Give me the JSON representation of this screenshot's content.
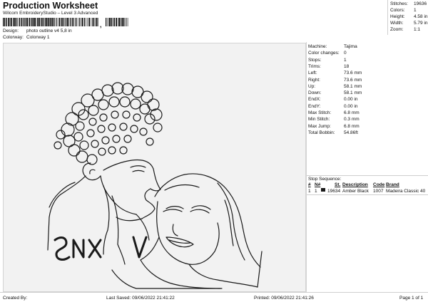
{
  "header": {
    "title": "Production Worksheet",
    "subtitle": "Wilcom EmbroideryStudio – Level 3 Advanced",
    "barcode_suffix": ","
  },
  "info": {
    "design_label": "Design:",
    "design_value": "photo outline v4 5,8 in",
    "colorway_label": "Colorway:",
    "colorway_value": "Colorway 1"
  },
  "summary": {
    "stitches_label": "Stitches:",
    "stitches_value": "19636",
    "colors_label": "Colors:",
    "colors_value": "1",
    "height_label": "Height:",
    "height_value": "4.58 in",
    "width_label": "Width:",
    "width_value": "5.79 in",
    "zoom_label": "Zoom:",
    "zoom_value": "1:1"
  },
  "stats": [
    {
      "label": "Machine:",
      "value": "Tajima"
    },
    {
      "label": "Color changes:",
      "value": "0"
    },
    {
      "label": "Stops:",
      "value": "1"
    },
    {
      "label": "Trims:",
      "value": "18"
    },
    {
      "label": "Left:",
      "value": "73.6 mm"
    },
    {
      "label": "Right:",
      "value": "73.6 mm"
    },
    {
      "label": "Up:",
      "value": "58.1 mm"
    },
    {
      "label": "Down:",
      "value": "58.1 mm"
    },
    {
      "label": "EndX:",
      "value": "0.00 in"
    },
    {
      "label": "EndY:",
      "value": "0.00 in"
    },
    {
      "label": "Max Stitch:",
      "value": "6.8 mm"
    },
    {
      "label": "Min Stitch:",
      "value": "0.3 mm"
    },
    {
      "label": "Max Jump:",
      "value": "6.8 mm"
    },
    {
      "label": "Total Bobbin:",
      "value": "54.86ft"
    }
  ],
  "stop_sequence": {
    "label": "Stop Sequence:",
    "columns": {
      "num": "#",
      "n": "N#",
      "st": "St.",
      "description": "Description",
      "code": "Code",
      "brand": "Brand"
    },
    "rows": [
      {
        "num": "1",
        "n": "1",
        "st": "19634",
        "description": "Amber Black",
        "code": "1007",
        "brand": "Madeira Classic 40",
        "color": "#1a1a1a"
      }
    ]
  },
  "footer": {
    "created_by": "Created By:",
    "last_saved": "Last Saved: 09/06/2022 21:41:22",
    "printed": "Printed: 09/06/2022 21:41:26",
    "page": "Page 1 of 1"
  },
  "colors": {
    "canvas_bg": "#f2f2f2",
    "thread": "#1a1a1a"
  }
}
